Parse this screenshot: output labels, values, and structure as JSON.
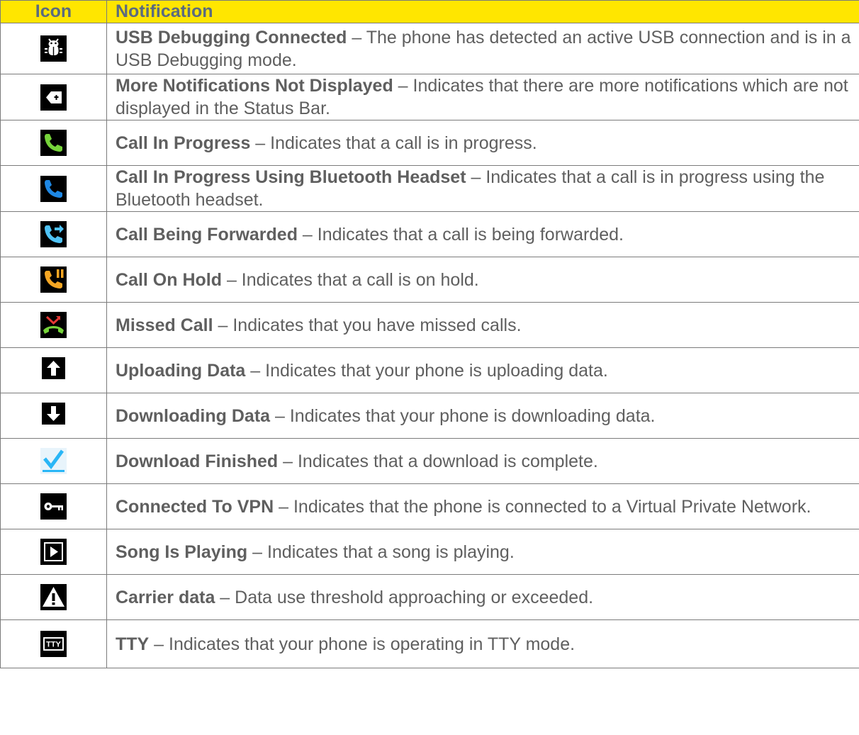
{
  "header": {
    "icon": "Icon",
    "notification": "Notification"
  },
  "rows": [
    {
      "icon": "usb-debug-icon",
      "term": "USB Debugging Connected",
      "desc": " – The phone has detected an active USB connection and is in a USB Debugging mode."
    },
    {
      "icon": "more-notifications-icon",
      "term": "More Notifications Not Displayed",
      "desc": " – Indicates that there are more notifications which are not displayed in the Status Bar."
    },
    {
      "icon": "call-in-progress-icon",
      "term": "Call In Progress",
      "desc": " – Indicates that a call is in progress."
    },
    {
      "icon": "call-bluetooth-icon",
      "term": "Call In Progress Using Bluetooth Headset",
      "desc": " – Indicates that a call is in progress using the Bluetooth headset."
    },
    {
      "icon": "call-forward-icon",
      "term": "Call Being Forwarded",
      "desc": " – Indicates that a call is being forwarded."
    },
    {
      "icon": "call-hold-icon",
      "term": "Call On Hold",
      "desc": " – Indicates that a call is on hold."
    },
    {
      "icon": "missed-call-icon",
      "term": "Missed Call",
      "desc": " – Indicates that you have missed calls."
    },
    {
      "icon": "upload-icon",
      "term": "Uploading Data",
      "desc": " – Indicates that your phone is uploading data."
    },
    {
      "icon": "download-icon",
      "term": "Downloading Data",
      "desc": " – Indicates that your phone is downloading data."
    },
    {
      "icon": "download-finished-icon",
      "term": "Download Finished",
      "desc": " – Indicates that a download is complete."
    },
    {
      "icon": "vpn-key-icon",
      "term": "Connected To VPN",
      "desc": " – Indicates that the phone is connected to a Virtual Private Network."
    },
    {
      "icon": "play-icon",
      "term": "Song Is Playing",
      "desc": " – Indicates that a song is playing."
    },
    {
      "icon": "warning-icon",
      "term": "Carrier data",
      "desc": " – Data use threshold approaching or exceeded."
    },
    {
      "icon": "tty-icon",
      "term": "TTY",
      "desc": " – Indicates that your phone is operating in TTY mode.",
      "icon_text": "TTY"
    }
  ],
  "colors": {
    "header_bg": "#ffe600",
    "header_text": "#5b6b7f",
    "body_text": "#5f5f5f",
    "border": "#7b7b7b",
    "call_green": "#76d43a",
    "call_blue": "#1e88e5",
    "call_cyan": "#4fc3f7",
    "call_orange": "#f5a623",
    "missed_red": "#e53935",
    "check_blue": "#29b6f6"
  }
}
